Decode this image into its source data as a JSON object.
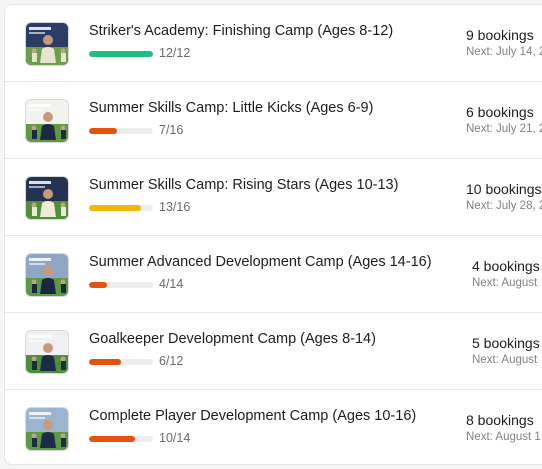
{
  "camps": [
    {
      "title": "Striker's Academy: Finishing Camp (Ages 8-12)",
      "enrolled": 12,
      "capacity": 12,
      "count_label": "12/12",
      "bar_color": "#1fbf83",
      "bookings": "9 bookings",
      "next": "Next: July 14, 2",
      "thumbnail": "striker-camp-photo",
      "thumb_colors": [
        "#2b3d66",
        "#6aa04a",
        "#e8e2d0"
      ]
    },
    {
      "title": "Summer Skills Camp: Little Kicks (Ages 6-9)",
      "enrolled": 7,
      "capacity": 16,
      "count_label": "7/16",
      "bar_color": "#e8520f",
      "bookings": "6 bookings",
      "next": "Next: July 21, 2",
      "thumbnail": "little-kicks-photo",
      "thumb_colors": [
        "#f2f2ee",
        "#5f9a3e",
        "#1e2a44"
      ]
    },
    {
      "title": "Summer Skills Camp: Rising Stars (Ages 10-13)",
      "enrolled": 13,
      "capacity": 16,
      "count_label": "13/16",
      "bar_color": "#f2b705",
      "bookings": "10 bookings",
      "next": "Next: July 28, 2",
      "thumbnail": "rising-stars-photo",
      "thumb_colors": [
        "#243352",
        "#4f8f38",
        "#efe9d8"
      ]
    },
    {
      "title": "Summer Advanced Development Camp (Ages 14-16)",
      "enrolled": 4,
      "capacity": 14,
      "count_label": "4/14",
      "bar_color": "#e8520f",
      "bookings": "4 bookings",
      "next": "Next: August",
      "thumbnail": "advanced-camp-photo",
      "thumb_colors": [
        "#8fa7c4",
        "#5a9a44",
        "#1c2640"
      ]
    },
    {
      "title": "Goalkeeper Development Camp (Ages 8-14)",
      "enrolled": 6,
      "capacity": 12,
      "count_label": "6/12",
      "bar_color": "#e8520f",
      "bookings": "5 bookings",
      "next": "Next: August",
      "thumbnail": "goalkeeper-camp-photo",
      "thumb_colors": [
        "#eef0f3",
        "#4e8f3a",
        "#1d2a45"
      ]
    },
    {
      "title": "Complete Player Development Camp (Ages 10-16)",
      "enrolled": 10,
      "capacity": 14,
      "count_label": "10/14",
      "bar_color": "#e8520f",
      "bookings": "8 bookings",
      "next": "Next: August 1",
      "thumbnail": "complete-player-photo",
      "thumb_colors": [
        "#9bb4cf",
        "#5c9b46",
        "#1e2b47"
      ]
    }
  ]
}
